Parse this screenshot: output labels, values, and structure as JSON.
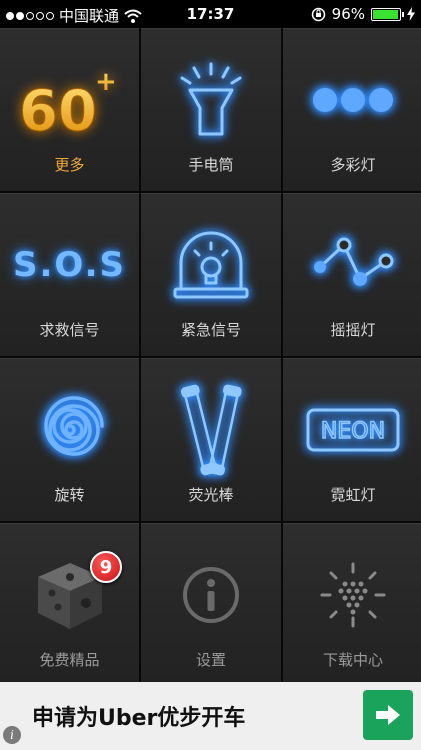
{
  "status_bar": {
    "carrier": "中国联通",
    "time": "17:37",
    "battery": "96%",
    "battery_level": 0.96,
    "signal_bars_filled": 2,
    "signal_bars_total": 5
  },
  "tiles": [
    {
      "label": "更多",
      "icon": "60-plus-icon",
      "icon_text": "60",
      "icon_sup": "+"
    },
    {
      "label": "手电筒",
      "icon": "flashlight-icon"
    },
    {
      "label": "多彩灯",
      "icon": "three-dots-icon"
    },
    {
      "label": "求救信号",
      "icon": "sos-icon",
      "icon_text": "S.O.S"
    },
    {
      "label": "紧急信号",
      "icon": "siren-icon"
    },
    {
      "label": "摇摇灯",
      "icon": "zigzag-line-icon"
    },
    {
      "label": "旋转",
      "icon": "spiral-icon"
    },
    {
      "label": "荧光棒",
      "icon": "glow-sticks-icon"
    },
    {
      "label": "霓虹灯",
      "icon": "neon-sign-icon",
      "icon_text": "NEON"
    },
    {
      "label": "免费精品",
      "icon": "dice-icon",
      "badge": "9"
    },
    {
      "label": "设置",
      "icon": "info-icon"
    },
    {
      "label": "下载中心",
      "icon": "loading-sun-icon"
    }
  ],
  "ad": {
    "text": "申请为Uber优步开车",
    "info_label": "i"
  },
  "colors": {
    "accent_blue": "#2f8cff",
    "accent_orange": "#f2a93b",
    "ad_button_green": "#1aa35b",
    "badge_red": "#d41a1a"
  }
}
